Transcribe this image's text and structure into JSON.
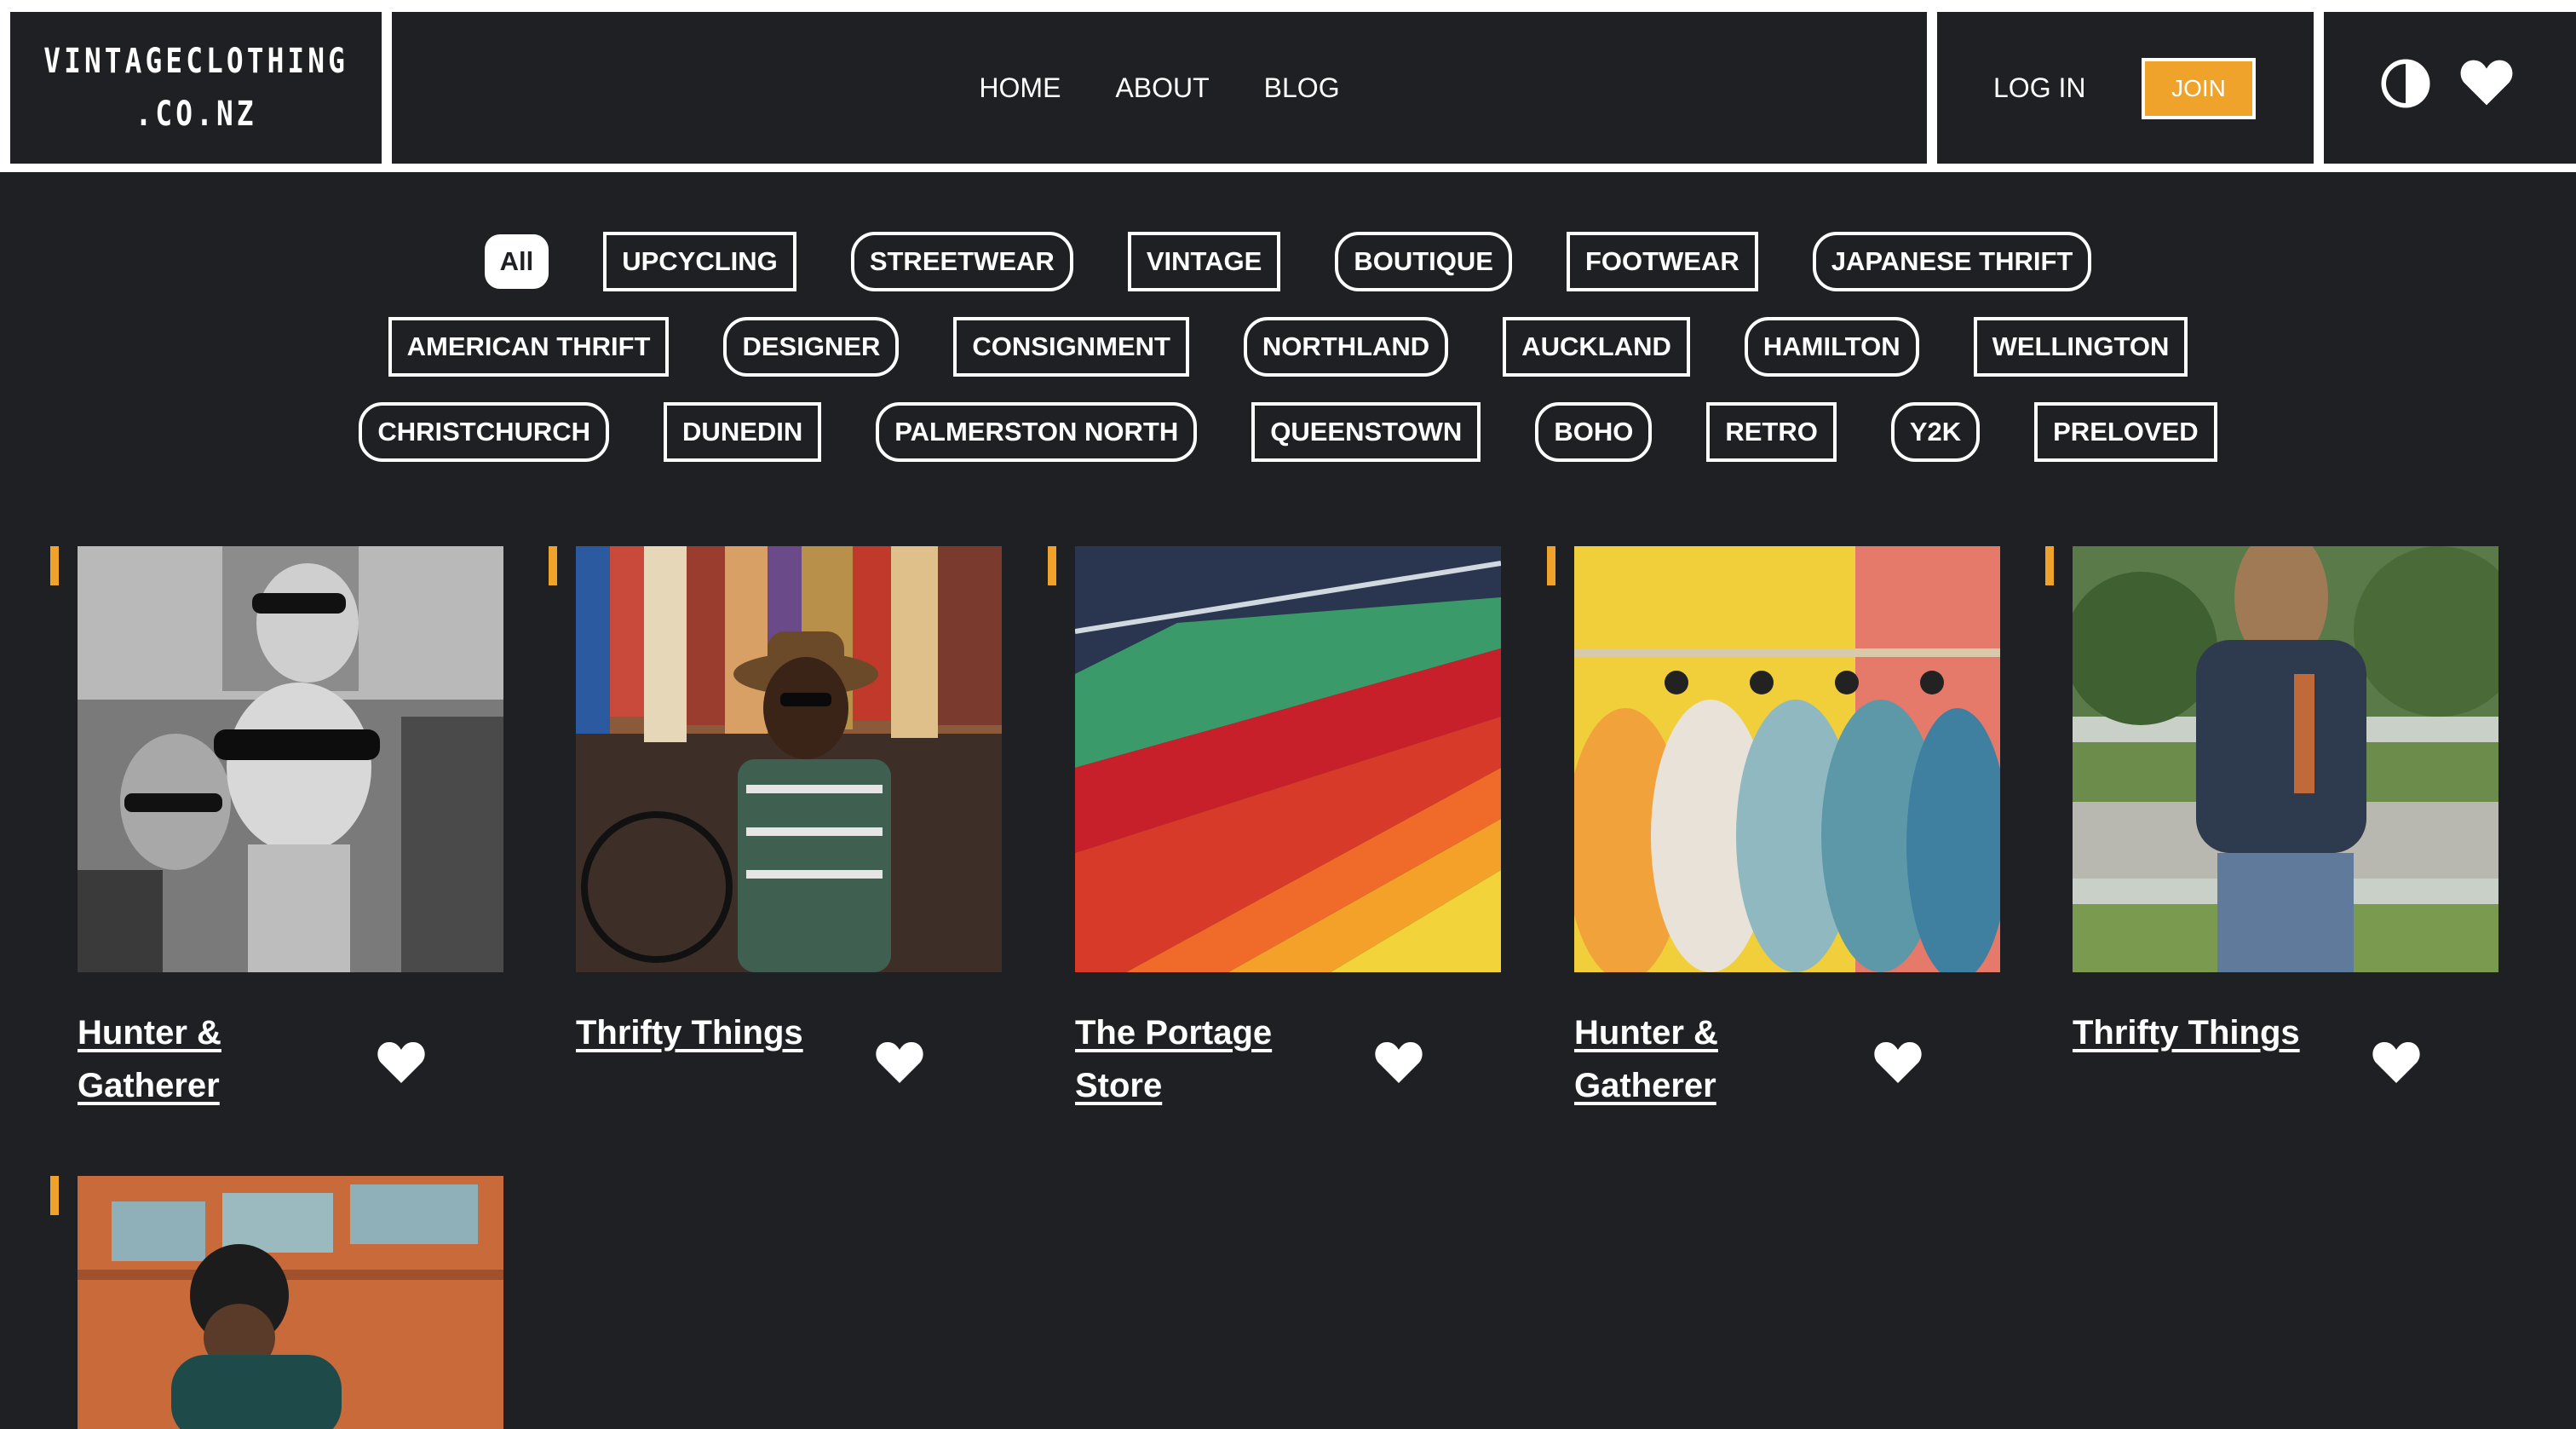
{
  "header": {
    "logo_line1": "VINTAGECLOTHING",
    "logo_line2": ".CO.NZ",
    "nav": [
      {
        "label": "HOME"
      },
      {
        "label": "ABOUT"
      },
      {
        "label": "BLOG"
      }
    ],
    "login_label": "LOG IN",
    "join_label": "JOIN",
    "icons": [
      "theme-toggle-icon",
      "favorites-heart-icon"
    ]
  },
  "filters": {
    "active": "All",
    "rows": [
      [
        "All",
        "UPCYCLING",
        "STREETWEAR",
        "VINTAGE",
        "BOUTIQUE",
        "FOOTWEAR",
        "JAPANESE THRIFT"
      ],
      [
        "AMERICAN THRIFT",
        "DESIGNER",
        "CONSIGNMENT",
        "NORTHLAND",
        "AUCKLAND",
        "HAMILTON",
        "WELLINGTON"
      ],
      [
        "CHRISTCHURCH",
        "DUNEDIN",
        "PALMERSTON NORTH",
        "QUEENSTOWN",
        "BOHO",
        "RETRO",
        "Y2K",
        "PRELOVED"
      ]
    ]
  },
  "stores": [
    {
      "title": "Hunter & Gatherer",
      "image": "mannequin heads with sunglasses (black and white)"
    },
    {
      "title": "Thrifty Things",
      "image": "man with hat and sunglasses beside bicycle and clothing rack"
    },
    {
      "title": "The Portage Store",
      "image": "colorful shirts on hangers"
    },
    {
      "title": "Hunter & Gatherer",
      "image": "pastel puffer jackets on rail"
    },
    {
      "title": "Thrifty Things",
      "image": "woman in denim jacket outdoors"
    },
    {
      "title": "",
      "image": "man in beanie in front of orange door"
    }
  ],
  "colors": {
    "background": "#1f2024",
    "accent": "#f0a32b",
    "text": "#ffffff"
  }
}
